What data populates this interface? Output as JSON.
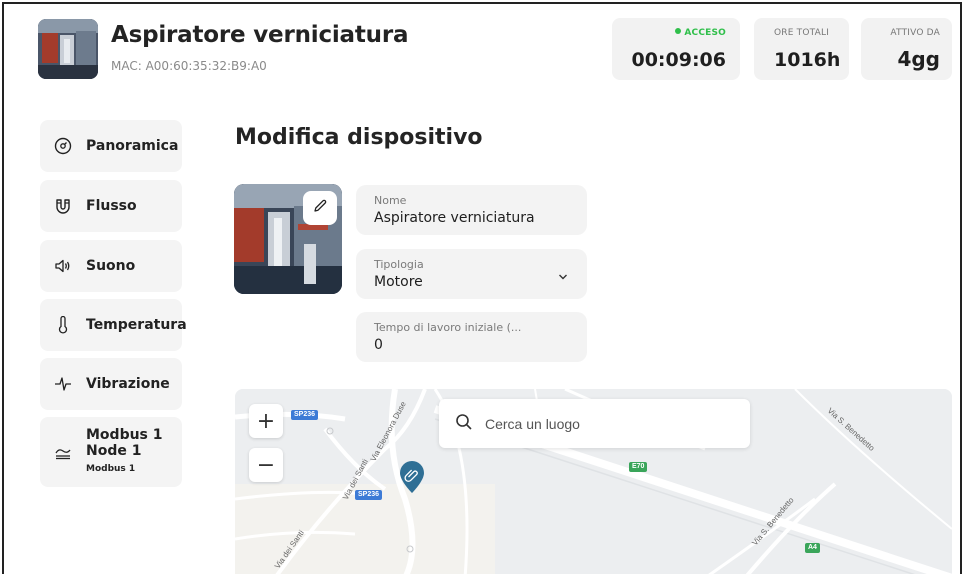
{
  "header": {
    "device_name": "Aspiratore verniciatura",
    "mac": "MAC: A00:60:35:32:B9:A0"
  },
  "stats": {
    "acceso": {
      "label": "ACCESO",
      "value": "00:09:06",
      "color": "#2fbf4a"
    },
    "ore_totali": {
      "label": "ORE TOTALI",
      "value": "1016h"
    },
    "attivo_da": {
      "label": "ATTIVO DA",
      "value": "4gg"
    }
  },
  "sidebar": {
    "items": [
      {
        "label": "Panoramica",
        "icon": "gauge-icon"
      },
      {
        "label": "Flusso",
        "icon": "magnet-icon"
      },
      {
        "label": "Suono",
        "icon": "speaker-icon"
      },
      {
        "label": "Temperatura",
        "icon": "thermometer-icon"
      },
      {
        "label": "Vibrazione",
        "icon": "pulse-icon"
      },
      {
        "label_line1": "Modbus 1",
        "label_line2": "Node 1",
        "sublabel": "Modbus 1",
        "icon": "modbus-icon"
      }
    ]
  },
  "main": {
    "page_title": "Modifica dispositivo",
    "fields": {
      "nome": {
        "label": "Nome",
        "value": "Aspiratore verniciatura"
      },
      "tipologia": {
        "label": "Tipologia",
        "value": "Motore"
      },
      "tempo": {
        "label": "Tempo di lavoro iniziale (...",
        "value": "0"
      }
    }
  },
  "map": {
    "search_placeholder": "Cerca un luogo",
    "zoom_in": "+",
    "zoom_out": "−",
    "labels": {
      "sp236_a": "SP236",
      "sp236_b": "SP236",
      "e70": "E70",
      "a4": "A4",
      "via_eleonora_duse": "Via Eleonora Duse",
      "via_dei_santi_1": "Via dei Santi",
      "via_dei_santi_2": "Via dei Santi",
      "via_s_benedetto_1": "Via S. Benedetto",
      "via_s_benedetto_2": "Via S. Benedetto"
    }
  }
}
